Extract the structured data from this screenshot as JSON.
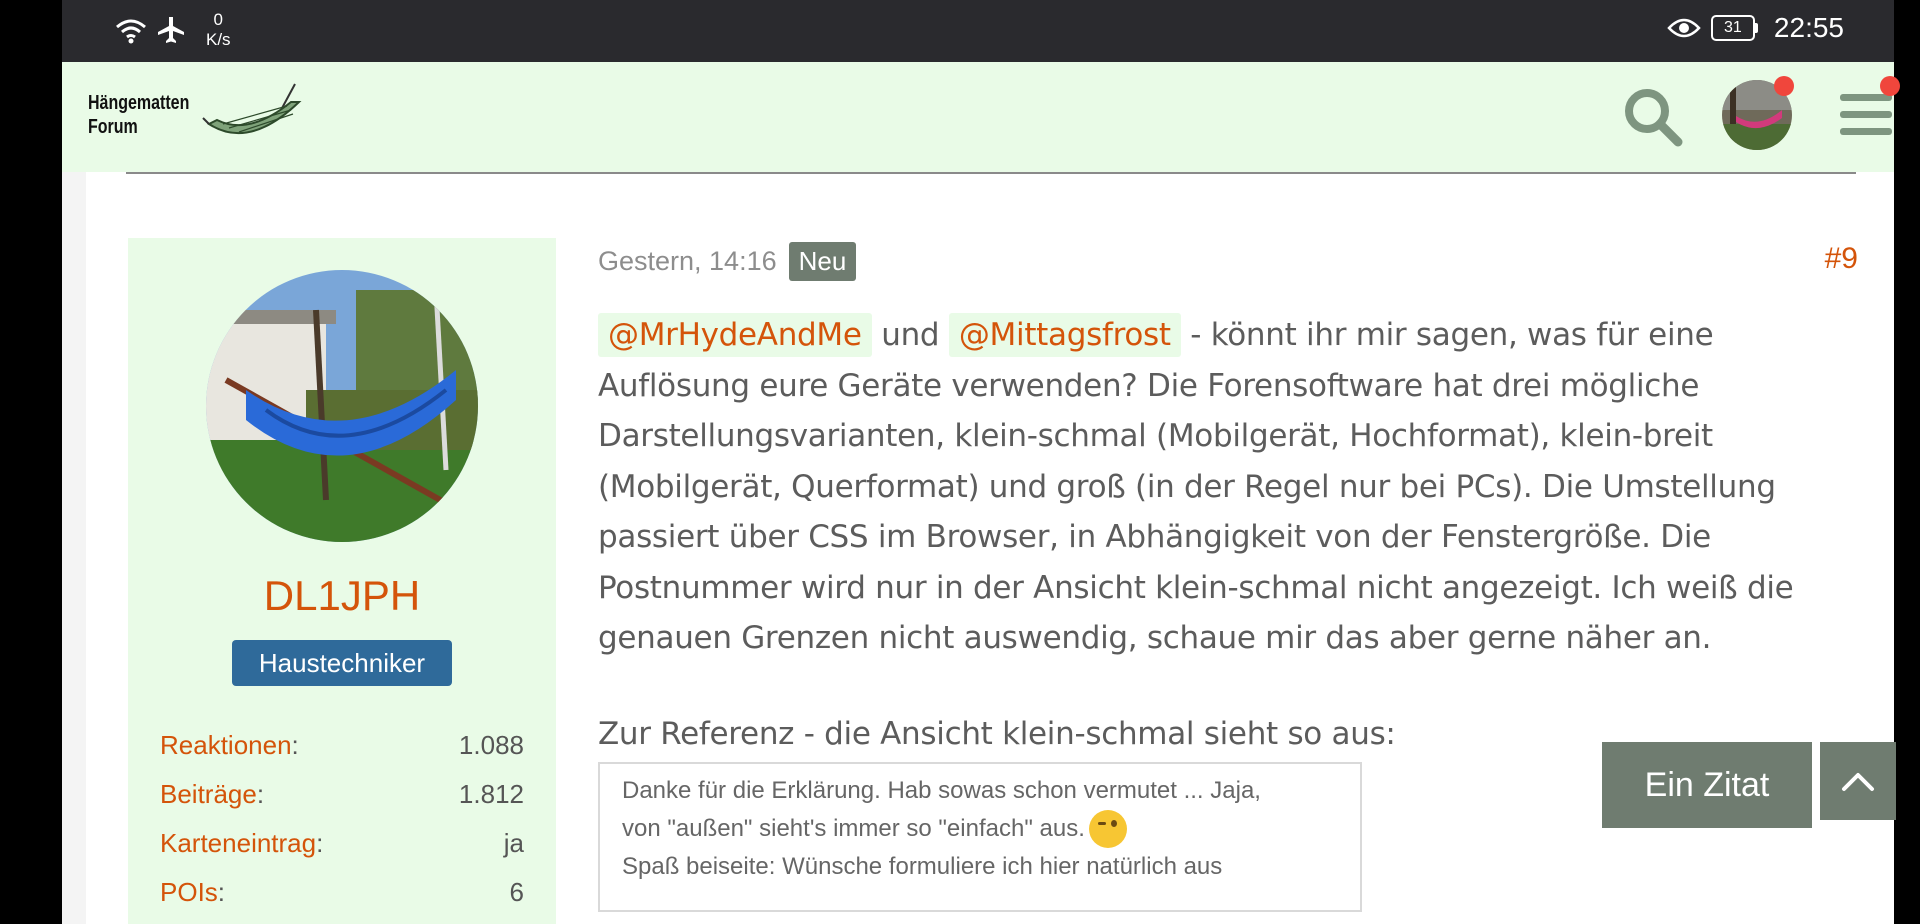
{
  "status_bar": {
    "speed_value": "0",
    "speed_unit": "K/s",
    "battery": "31",
    "time": "22:55"
  },
  "header": {
    "logo_line1": "Hängematten",
    "logo_line2": "Forum",
    "notification_color": "#f0463c",
    "background": "#e9fbe7"
  },
  "user": {
    "name": "DL1JPH",
    "role": "Haustechniker",
    "stats": [
      {
        "label": "Reaktionen",
        "value": "1.088"
      },
      {
        "label": "Beiträge",
        "value": "1.812"
      },
      {
        "label": "Karteneintrag",
        "value": "ja"
      },
      {
        "label": "POIs",
        "value": "6"
      }
    ]
  },
  "post": {
    "date": "Gestern, 14:16",
    "badge": "Neu",
    "number": "#9",
    "mention1": "@MrHydeAndMe",
    "connector": "und",
    "mention2": "@Mittagsfrost",
    "body_line1_rest": "- könnt ihr mir sagen, was für eine",
    "body_rest": "Auflösung eure Geräte verwenden? Die Forensoftware hat drei mögliche Darstellungsvarianten, klein-schmal (Mobilgerät, Hochformat), klein-breit (Mobilgerät, Querformat) und groß (in der Regel nur bei PCs). Die Umstellung passiert über CSS im Browser, in Abhängigkeit von der Fenstergröße. Die Postnummer wird nur in der Ansicht klein-schmal nicht angezeigt. Ich weiß die genauen Grenzen nicht auswendig, schaue mir das aber gerne näher an.",
    "reference_line": "Zur Referenz - die Ansicht klein-schmal sieht so aus:",
    "quote_line1": "Danke für die Erklärung. Hab sowas schon vermutet ... Jaja,",
    "quote_line2": "von \"außen\" sieht's immer so \"einfach\" aus.",
    "quote_line3": "Spaß beiseite: Wünsche formuliere ich hier natürlich aus"
  },
  "actions": {
    "quote_button": "Ein Zitat"
  },
  "colors": {
    "accent": "#d4540a",
    "button": "#6f7c70",
    "role_badge": "#2f6a9a"
  }
}
